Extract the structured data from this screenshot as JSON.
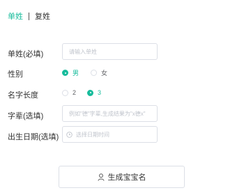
{
  "tabs": {
    "active": "单姓",
    "other": "复姓"
  },
  "form": {
    "surname": {
      "label": "单姓(必填)",
      "placeholder": "请输入单姓"
    },
    "gender": {
      "label": "性别",
      "options": [
        "男",
        "女"
      ],
      "selected": "男"
    },
    "name_length": {
      "label": "名字长度",
      "options": [
        "2",
        "3"
      ],
      "selected": "3"
    },
    "generation": {
      "label": "字辈(选填)",
      "placeholder": "例如\"德\"字辈,生成结果为\"x德x\""
    },
    "birth_date": {
      "label": "出生日期(选填)",
      "placeholder": "选择日期时间"
    }
  },
  "actions": {
    "generate_label": "生成宝宝名"
  },
  "colors": {
    "accent": "#18bc9c",
    "border": "#dcdfe6",
    "placeholder": "#c0c4cc"
  },
  "icons": {
    "date": "calendar-icon",
    "generate": "user-icon"
  }
}
